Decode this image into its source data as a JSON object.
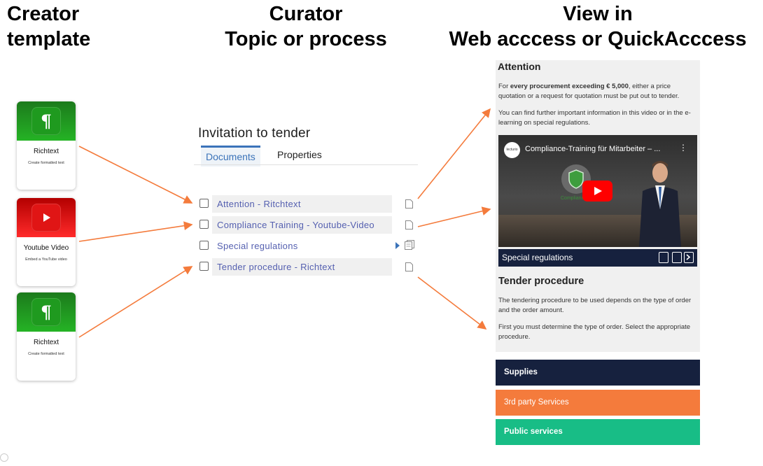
{
  "columns": {
    "creator": {
      "line1": "Creator",
      "line2": "template"
    },
    "curator": {
      "line1": "Curator",
      "line2": "Topic or process"
    },
    "view": {
      "line1": "View in",
      "line2": "Web acccess or QuickAcccess"
    }
  },
  "templates": [
    {
      "name": "Richtext",
      "desc": "Create formatted text",
      "icon": "pilcrow-icon"
    },
    {
      "name": "Youtube Video",
      "desc": "Embed a YouTube video",
      "icon": "youtube-play-icon"
    },
    {
      "name": "Richtext",
      "desc": "Create formatted text",
      "icon": "pilcrow-icon"
    }
  ],
  "curator": {
    "title": "Invitation to tender",
    "tabs": [
      "Documents",
      "Properties"
    ],
    "documents": [
      {
        "label": "Attention - Ritchtext"
      },
      {
        "label": "Compliance Training - Youtube-Video"
      },
      {
        "label": "Special regulations"
      },
      {
        "label": "Tender procedure - Richtext"
      }
    ]
  },
  "view": {
    "attention": {
      "heading": "Attention",
      "p1_pre": "For ",
      "p1_bold": "every procurement exceeding € 5,000",
      "p1_post": ", either a price quotation or a request for quotation must be put out to tender.",
      "p2": "You can find further important information in this video or in the e-learning on special regulations."
    },
    "video": {
      "title": "Compliance-Training für Mitarbeiter – ...",
      "logo": "lecturio",
      "overlay": "Compliance"
    },
    "special_bar": "Special regulations",
    "tender": {
      "heading": "Tender procedure",
      "p1": "The tendering procedure to be used depends on the type of order and the order amount.",
      "p2": "First you must determine the type of order. Select the appropriate procedure."
    },
    "buttons": [
      "Supplies",
      "3rd party Services",
      "Public services"
    ]
  },
  "colors": {
    "accent": "#3b73b9",
    "arrow": "#f47b3c",
    "navy": "#16213e",
    "orange": "#f47b3c",
    "green": "#18bd86",
    "link": "#5560b0"
  }
}
